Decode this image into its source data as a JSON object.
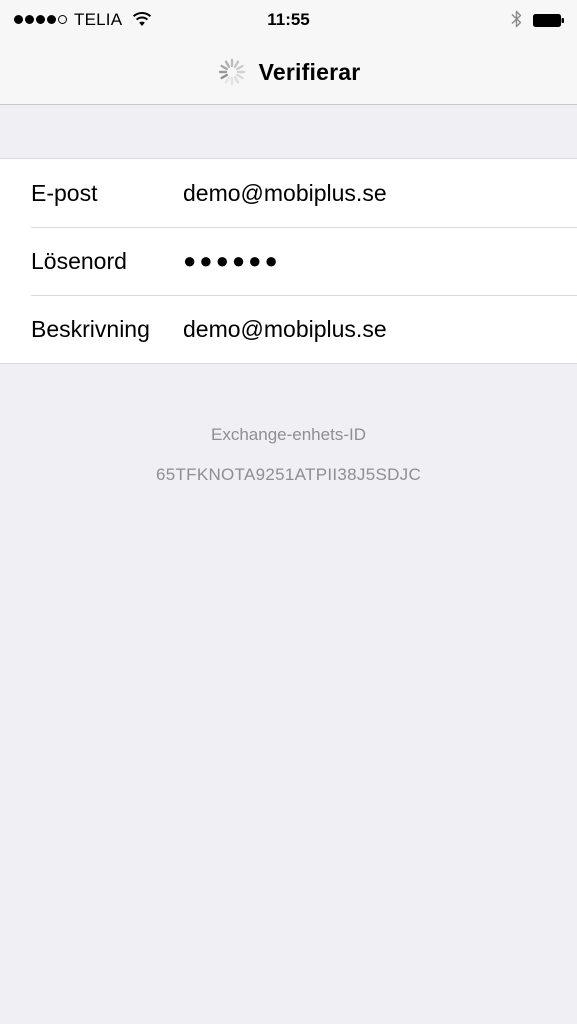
{
  "status_bar": {
    "carrier": "TELIA",
    "time": "11:55",
    "signal_filled": 4,
    "signal_total": 5,
    "icons": [
      "wifi-icon",
      "bluetooth-icon",
      "battery-icon"
    ]
  },
  "nav": {
    "title": "Verifierar",
    "icon": "spinner-icon"
  },
  "form": {
    "rows": [
      {
        "label": "E-post",
        "value": "demo@mobiplus.se"
      },
      {
        "label": "Lösenord",
        "value": "●●●●●●"
      },
      {
        "label": "Beskrivning",
        "value": "demo@mobiplus.se"
      }
    ]
  },
  "device": {
    "label": "Exchange-enhets-ID",
    "id": "65TFKNOTA9251ATPII38J5SDJC"
  },
  "colors": {
    "background": "#efeff4",
    "bar": "#f7f7f7",
    "secondary_text": "#8e8e93",
    "separator": "#d9d9de"
  }
}
